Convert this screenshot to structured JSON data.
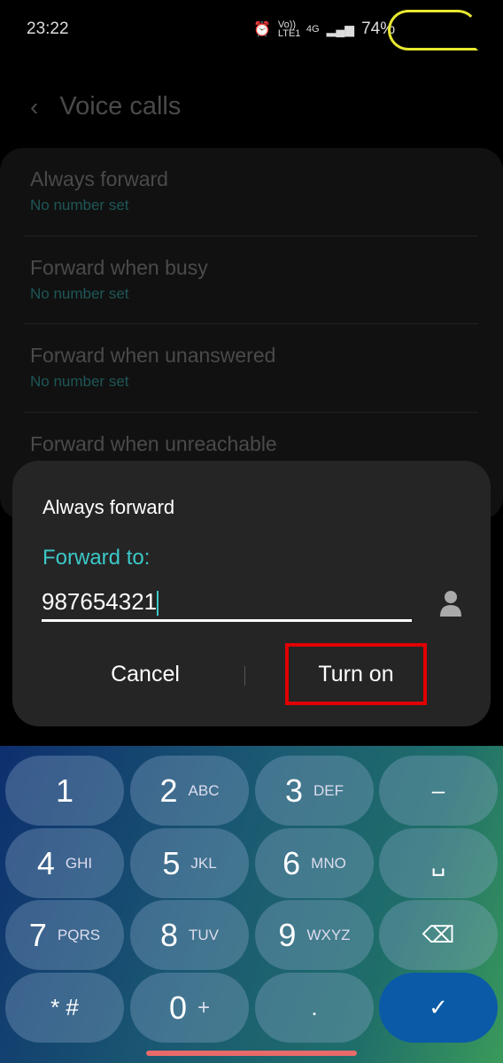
{
  "status": {
    "time": "23:22",
    "alarm_icon": "alarm-icon",
    "volte": "Vo)) LTE1",
    "network": "4G",
    "battery": "74%"
  },
  "header": {
    "title": "Voice calls",
    "back_icon": "chevron-left-icon"
  },
  "list": [
    {
      "title": "Always forward",
      "subtitle": "No number set"
    },
    {
      "title": "Forward when busy",
      "subtitle": "No number set"
    },
    {
      "title": "Forward when unanswered",
      "subtitle": "No number set"
    },
    {
      "title": "Forward when unreachable"
    }
  ],
  "dialog": {
    "title": "Always forward",
    "label": "Forward to:",
    "value": "987654321",
    "contact_icon": "person-icon",
    "cancel": "Cancel",
    "confirm": "Turn on",
    "highlight_color": "#e00000"
  },
  "keypad": [
    [
      {
        "n": "1",
        "l": ""
      },
      {
        "n": "2",
        "l": "ABC"
      },
      {
        "n": "3",
        "l": "DEF"
      },
      {
        "n": "–",
        "l": ""
      }
    ],
    [
      {
        "n": "4",
        "l": "GHI"
      },
      {
        "n": "5",
        "l": "JKL"
      },
      {
        "n": "6",
        "l": "MNO"
      },
      {
        "n": "␣",
        "l": ""
      }
    ],
    [
      {
        "n": "7",
        "l": "PQRS"
      },
      {
        "n": "8",
        "l": "TUV"
      },
      {
        "n": "9",
        "l": "WXYZ"
      },
      {
        "n": "⌫",
        "l": ""
      }
    ],
    [
      {
        "n": "* #",
        "l": ""
      },
      {
        "n": "0",
        "l": "+"
      },
      {
        "n": ".",
        "l": ""
      },
      {
        "n": "✓",
        "l": ""
      }
    ]
  ]
}
